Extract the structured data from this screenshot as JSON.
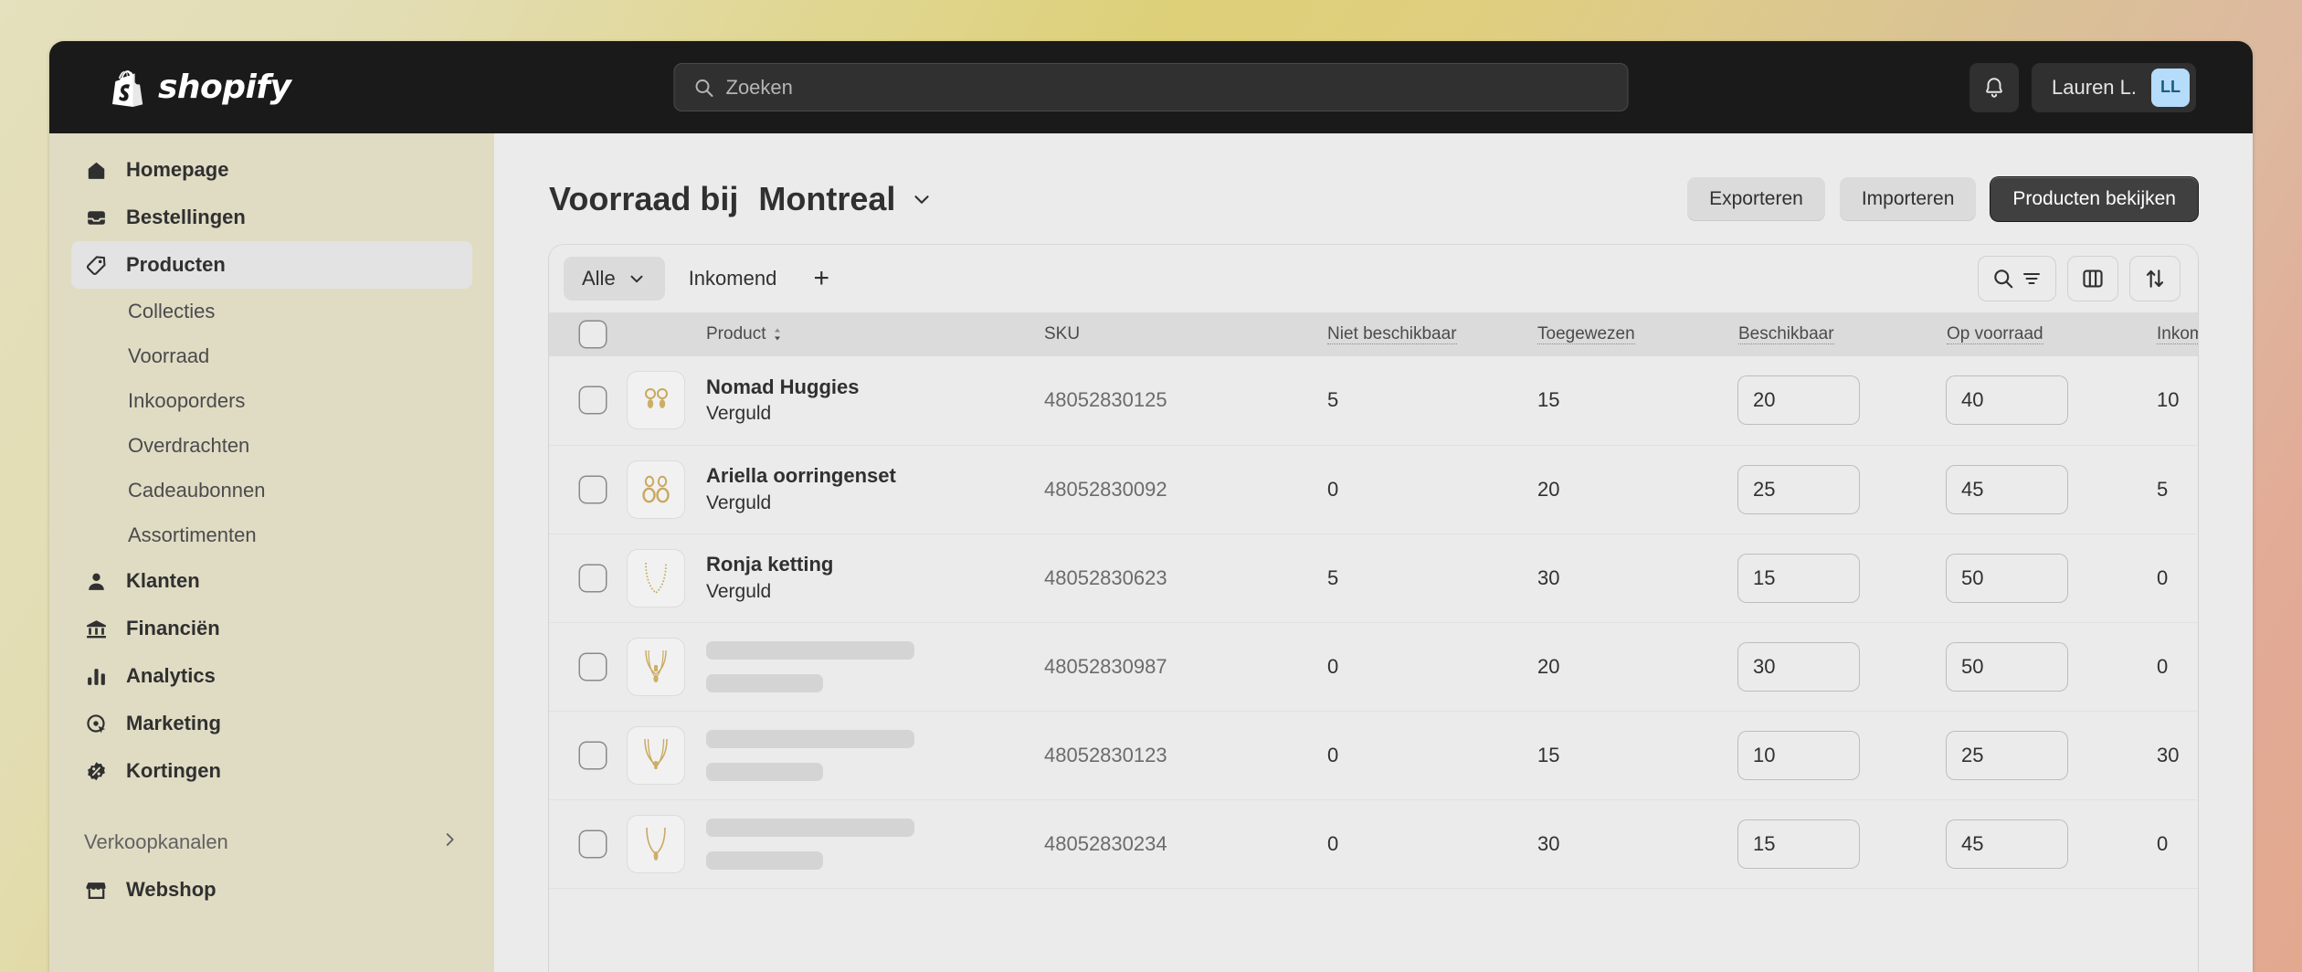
{
  "topbar": {
    "brand": "shopify",
    "search_placeholder": "Zoeken",
    "user_name": "Lauren L.",
    "user_initials": "LL"
  },
  "sidebar": {
    "items": [
      {
        "label": "Homepage",
        "icon": "home-icon",
        "type": "main",
        "active": false
      },
      {
        "label": "Bestellingen",
        "icon": "orders-icon",
        "type": "main",
        "active": false
      },
      {
        "label": "Producten",
        "icon": "tag-icon",
        "type": "main",
        "active": true
      },
      {
        "label": "Collecties",
        "type": "sub"
      },
      {
        "label": "Voorraad",
        "type": "sub"
      },
      {
        "label": "Inkooporders",
        "type": "sub"
      },
      {
        "label": "Overdrachten",
        "type": "sub"
      },
      {
        "label": "Cadeaubonnen",
        "type": "sub"
      },
      {
        "label": "Assortimenten",
        "type": "sub"
      },
      {
        "label": "Klanten",
        "icon": "person-icon",
        "type": "main",
        "active": false
      },
      {
        "label": "Financiën",
        "icon": "bank-icon",
        "type": "main",
        "active": false
      },
      {
        "label": "Analytics",
        "icon": "chart-icon",
        "type": "main",
        "active": false
      },
      {
        "label": "Marketing",
        "icon": "target-icon",
        "type": "main",
        "active": false
      },
      {
        "label": "Kortingen",
        "icon": "discount-icon",
        "type": "main",
        "active": false
      }
    ],
    "section_label": "Verkoopkanalen",
    "channel": {
      "label": "Webshop",
      "icon": "store-icon"
    }
  },
  "page": {
    "title_prefix": "Voorraad bij",
    "location": "Montreal",
    "actions": {
      "export": "Exporteren",
      "import": "Importeren",
      "view_products": "Producten bekijken"
    }
  },
  "tabs": {
    "items": [
      {
        "label": "Alle",
        "active": true,
        "has_chevron": true
      },
      {
        "label": "Inkomend",
        "active": false,
        "has_chevron": false
      }
    ],
    "add_label": "+"
  },
  "table": {
    "columns": [
      {
        "key": "product",
        "label": "Product",
        "sortable": true,
        "underlined": false
      },
      {
        "key": "sku",
        "label": "SKU",
        "sortable": false,
        "underlined": false
      },
      {
        "key": "unavailable",
        "label": "Niet beschikbaar",
        "sortable": false,
        "underlined": true
      },
      {
        "key": "committed",
        "label": "Toegewezen",
        "sortable": false,
        "underlined": true
      },
      {
        "key": "available",
        "label": "Beschikbaar",
        "sortable": false,
        "underlined": true
      },
      {
        "key": "on_hand",
        "label": "Op voorraad",
        "sortable": false,
        "underlined": true
      },
      {
        "key": "incoming",
        "label": "Inkomend",
        "sortable": false,
        "underlined": true
      }
    ],
    "rows": [
      {
        "thumb": "earrings-drop-icon",
        "name": "Nomad Huggies",
        "variant": "Verguld",
        "skeleton": false,
        "sku": "48052830125",
        "unavailable": "5",
        "committed": "15",
        "available": "20",
        "on_hand": "40",
        "incoming": "10"
      },
      {
        "thumb": "earrings-hoop-icon",
        "name": "Ariella oorringenset",
        "variant": "Verguld",
        "skeleton": false,
        "sku": "48052830092",
        "unavailable": "0",
        "committed": "20",
        "available": "25",
        "on_hand": "45",
        "incoming": "5"
      },
      {
        "thumb": "necklace-chain-icon",
        "name": "Ronja ketting",
        "variant": "Verguld",
        "skeleton": false,
        "sku": "48052830623",
        "unavailable": "5",
        "committed": "30",
        "available": "15",
        "on_hand": "50",
        "incoming": "0"
      },
      {
        "thumb": "necklace-layered-icon",
        "name": "",
        "variant": "",
        "skeleton": true,
        "sku": "48052830987",
        "unavailable": "0",
        "committed": "20",
        "available": "30",
        "on_hand": "50",
        "incoming": "0"
      },
      {
        "thumb": "necklace-double-icon",
        "name": "",
        "variant": "",
        "skeleton": true,
        "sku": "48052830123",
        "unavailable": "0",
        "committed": "15",
        "available": "10",
        "on_hand": "25",
        "incoming": "30"
      },
      {
        "thumb": "necklace-pendant-icon",
        "name": "",
        "variant": "",
        "skeleton": true,
        "sku": "48052830234",
        "unavailable": "0",
        "committed": "30",
        "available": "15",
        "on_hand": "45",
        "incoming": "0"
      }
    ]
  },
  "colors": {
    "topbar": "#1a1a1a",
    "sidebar": "#e0dcc4",
    "surface": "#ebebeb",
    "avatar_bg": "#b5dcfb",
    "primary_button": "#404040",
    "gold": "#c9a95f"
  }
}
